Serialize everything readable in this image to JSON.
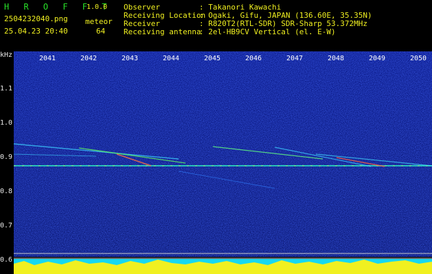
{
  "app": {
    "title": "H R O F F T",
    "version": "1.0.0"
  },
  "file": {
    "name": "2504232040.png",
    "datetime": "25.04.23 20:40"
  },
  "meteor": {
    "label": "meteor",
    "count": "64"
  },
  "info": [
    {
      "label": "Observer",
      "value": ": Takanori Kawachi"
    },
    {
      "label": "Receiving Location",
      "value": ": Ogaki, Gifu, JAPAN (136.60E, 35.35N)"
    },
    {
      "label": "Receiver",
      "value": ": R820T2(RTL-SDR) SDR-Sharp 53.372MHz"
    },
    {
      "label": "Receiving antenna",
      "value": ": 2el-HB9CV Vertical (el. E-W)"
    }
  ],
  "yaxis": {
    "unit": "kHz",
    "ticks": [
      "1.1",
      "1.0",
      "0.9",
      "0.8",
      "0.7",
      "0.6"
    ]
  },
  "xaxis": {
    "ticks": [
      "2041",
      "2042",
      "2043",
      "2044",
      "2045",
      "2046",
      "2047",
      "2048",
      "2049",
      "2050"
    ]
  },
  "colors": {
    "background": "#000000",
    "spectrum": "#0b1a8a",
    "accent_green": "#28e028",
    "accent_yellow": "#f0f020"
  }
}
